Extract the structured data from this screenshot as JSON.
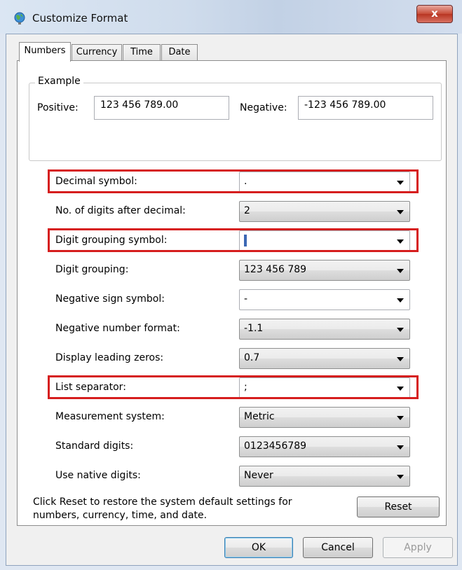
{
  "window": {
    "title": "Customize Format",
    "close_label": "x"
  },
  "tabs": [
    {
      "label": "Numbers",
      "active": true
    },
    {
      "label": "Currency",
      "active": false
    },
    {
      "label": "Time",
      "active": false
    },
    {
      "label": "Date",
      "active": false
    }
  ],
  "example": {
    "group_label": "Example",
    "positive_label": "Positive:",
    "positive_value": "123 456 789.00",
    "negative_label": "Negative:",
    "negative_value": "-123 456 789.00"
  },
  "settings": [
    {
      "label": "Decimal symbol:",
      "value": ".",
      "editable": true,
      "highlighted": true
    },
    {
      "label": "No. of digits after decimal:",
      "value": "2",
      "editable": false,
      "highlighted": false
    },
    {
      "label": "Digit grouping symbol:",
      "value": "",
      "editable": true,
      "highlighted": true
    },
    {
      "label": "Digit grouping:",
      "value": "123 456 789",
      "editable": false,
      "highlighted": false
    },
    {
      "label": "Negative sign symbol:",
      "value": "-",
      "editable": true,
      "highlighted": false
    },
    {
      "label": "Negative number format:",
      "value": "-1.1",
      "editable": false,
      "highlighted": false
    },
    {
      "label": "Display leading zeros:",
      "value": "0.7",
      "editable": false,
      "highlighted": false
    },
    {
      "label": "List separator:",
      "value": ";",
      "editable": true,
      "highlighted": true
    },
    {
      "label": "Measurement system:",
      "value": "Metric",
      "editable": false,
      "highlighted": false
    },
    {
      "label": "Standard digits:",
      "value": "0123456789",
      "editable": false,
      "highlighted": false
    },
    {
      "label": "Use native digits:",
      "value": "Never",
      "editable": false,
      "highlighted": false
    }
  ],
  "footer": {
    "note_line1": "Click Reset to restore the system default settings for",
    "note_line2": "numbers, currency, time, and date.",
    "reset_label": "Reset"
  },
  "buttons": {
    "ok_label": "OK",
    "cancel_label": "Cancel",
    "apply_label": "Apply"
  },
  "colors": {
    "highlight_border": "#d61e1e",
    "close_button": "#c74a36"
  },
  "icons": {
    "title": "globe-icon",
    "dropdown": "chevron-down-icon"
  }
}
